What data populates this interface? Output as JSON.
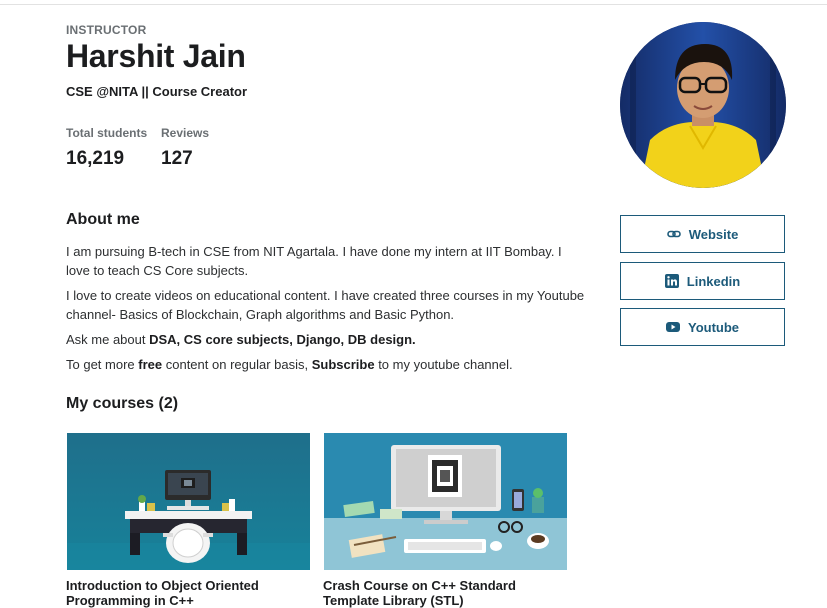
{
  "instructor": {
    "eyebrow": "INSTRUCTOR",
    "name": "Harshit Jain",
    "headline": "CSE @NITA || Course Creator"
  },
  "stats": [
    {
      "label": "Total students",
      "value": "16,219"
    },
    {
      "label": "Reviews",
      "value": "127"
    }
  ],
  "about": {
    "title": "About me",
    "p1": "I am pursuing B-tech in CSE from NIT Agartala. I have done my intern at IIT Bombay. I love to teach CS Core subjects.",
    "p2": "I love to create videos on educational content. I have created three courses in my Youtube channel- Basics of Blockchain, Graph algorithms and Basic Python.",
    "p3_prefix": "Ask me about ",
    "p3_bold": "DSA, CS core subjects, Django, DB design.",
    "p4_a": "To get more ",
    "p4_b": "free",
    "p4_c": " content on regular basis, ",
    "p4_d": "Subscribe",
    "p4_e": " to my youtube channel."
  },
  "courses": {
    "title": "My courses (2)",
    "items": [
      {
        "title": "Introduction to Object Oriented Programming in C++"
      },
      {
        "title": "Crash Course on C++ Standard Template Library (STL)"
      }
    ]
  },
  "links": [
    {
      "label": "Website",
      "icon": "link-icon"
    },
    {
      "label": "Linkedin",
      "icon": "linkedin-icon"
    },
    {
      "label": "Youtube",
      "icon": "youtube-icon"
    }
  ],
  "colors": {
    "accent": "#1c5a7a",
    "text": "#1c1d1f",
    "muted": "#6a6f73"
  }
}
